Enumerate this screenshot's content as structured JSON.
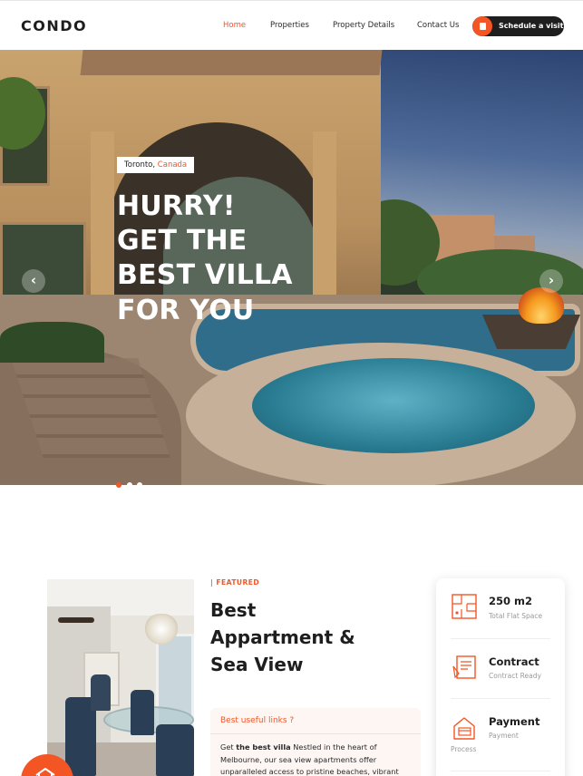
{
  "brand": {
    "logo": "CONDO",
    "accent": "#f35525",
    "dark": "#1e1e1e"
  },
  "nav": {
    "links": [
      {
        "label": "Home",
        "active": true
      },
      {
        "label": "Properties",
        "active": false
      },
      {
        "label": "Property Details",
        "active": false
      },
      {
        "label": "Contact Us",
        "active": false
      }
    ],
    "cta_label": "Schedule a visit",
    "cta_icon": "calendar-icon"
  },
  "hero": {
    "location_city": "Toronto,",
    "location_country": "Canada",
    "headline_lines": [
      "HURRY!",
      "GET THE",
      "BEST VILLA",
      "FOR YOU"
    ],
    "prev_arrow": "‹",
    "next_arrow": "›",
    "slides_total": 3,
    "active_slide": 1
  },
  "featured": {
    "tag": "| FEATURED",
    "title_lines": [
      "Best",
      "Appartment &",
      "Sea View"
    ],
    "links_heading": "Best useful links ?",
    "body_prefix": "Get ",
    "body_bold": "the best villa",
    "body_rest": " Nestled in the heart of Melbourne, our sea view apartments offer unparalleled access to pristine beaches, vibrant"
  },
  "stats": [
    {
      "title": "250 m2",
      "subtitle": "Total Flat Space",
      "icon": "floor-plan-icon"
    },
    {
      "title": "Contract",
      "subtitle": "Contract Ready",
      "icon": "contract-icon"
    },
    {
      "title": "Payment",
      "subtitle": "Payment",
      "subtitle2": "Process",
      "icon": "payment-icon"
    }
  ]
}
